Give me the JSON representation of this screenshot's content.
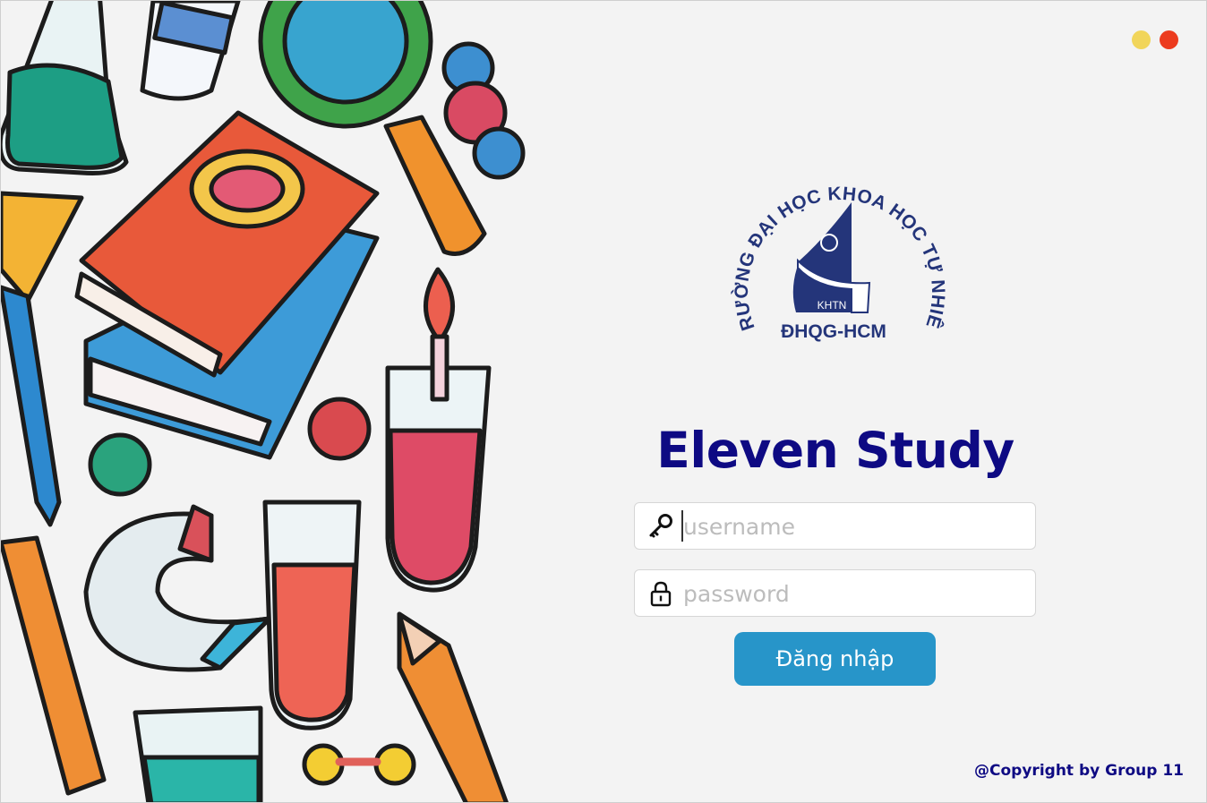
{
  "window": {
    "controls": [
      {
        "name": "minimize",
        "color": "#f1d55a"
      },
      {
        "name": "close",
        "color": "#ec3b1e"
      }
    ]
  },
  "logo": {
    "arc_text": "TRƯỜNG ĐẠI HỌC KHOA HỌC TỰ NHIÊN",
    "emblem_text": "KHTN",
    "bottom_text": "ĐHQG-HCM",
    "color": "#24357a"
  },
  "app": {
    "title": "Eleven Study",
    "title_color": "#0e0a83"
  },
  "form": {
    "username": {
      "value": "",
      "placeholder": "username",
      "icon": "key-icon"
    },
    "password": {
      "value": "",
      "placeholder": "password",
      "icon": "lock-icon"
    },
    "submit_label": "Đăng nhập",
    "submit_color": "#2795c9"
  },
  "footer": {
    "copyright": "@Copyright by Group 11"
  }
}
